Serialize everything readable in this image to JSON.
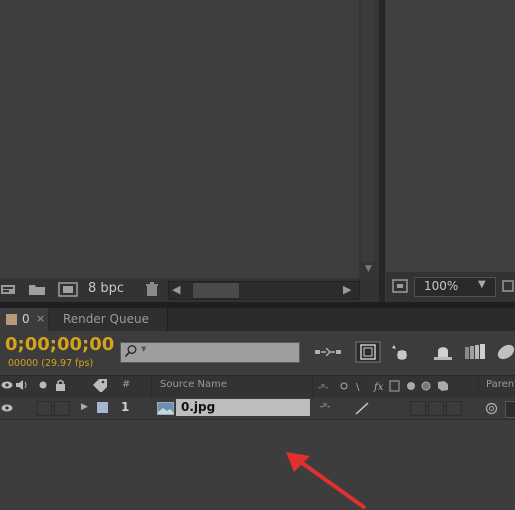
{
  "project_footer": {
    "bpc_label": "8 bpc",
    "icons": [
      "new-composition-icon",
      "folder-icon",
      "interpret-footage-icon",
      "trash-icon"
    ]
  },
  "comp_footer": {
    "zoom_value": "100%"
  },
  "tabs": [
    {
      "label": "0",
      "close": "×",
      "active": true,
      "swatch_color": "#b89a78"
    },
    {
      "label": "Render Queue",
      "active": false
    }
  ],
  "timeline": {
    "timecode": "0;00;00;00",
    "frame_info": "00000 (29.97 fps)",
    "timecode_color": "#d4a21c",
    "search_placeholder": ""
  },
  "columns": {
    "number": "#",
    "source_name": "Source Name",
    "parent": "Parent"
  },
  "layers": [
    {
      "number": "1",
      "name": "0.jpg",
      "label_color": "#a9b4d4"
    }
  ],
  "annotation": {
    "arrow_color": "#e03030"
  }
}
